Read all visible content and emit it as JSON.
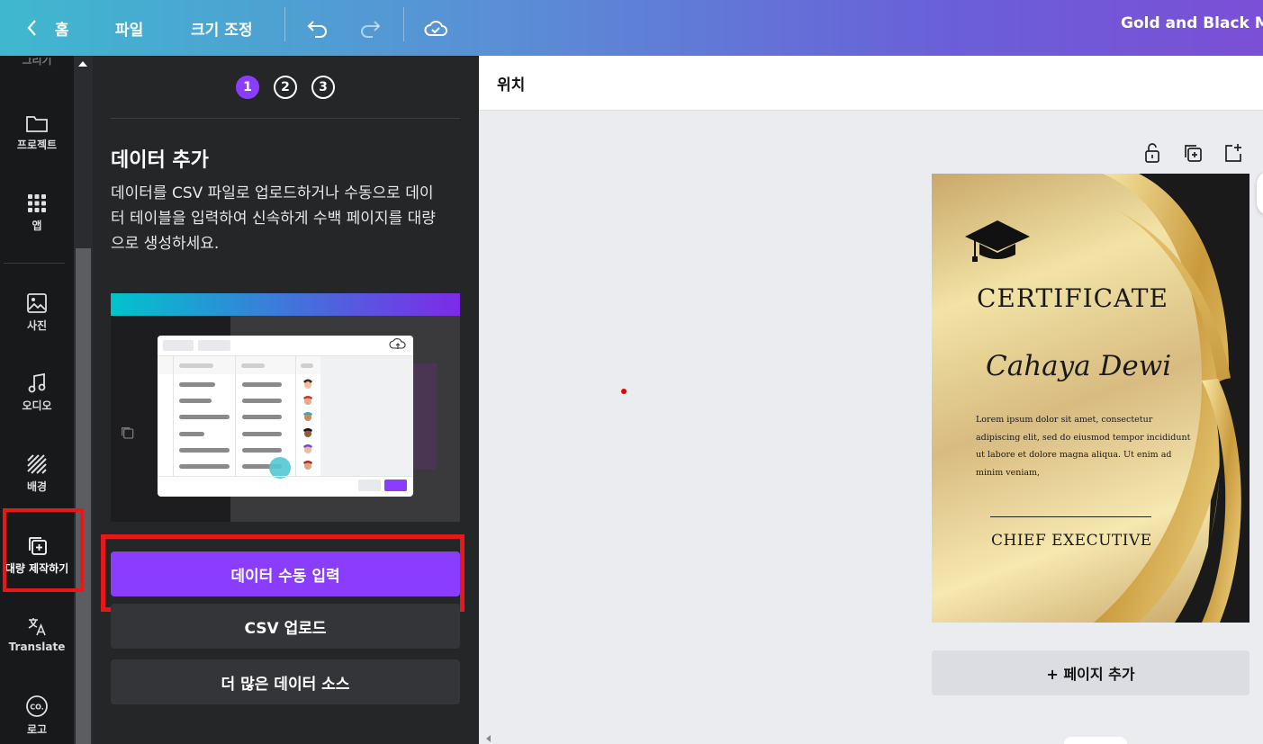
{
  "topbar": {
    "back_icon": "chevron-left-icon",
    "home_label": "홈",
    "file_label": "파일",
    "resize_label": "크기 조정",
    "undo_icon": "undo-icon",
    "redo_icon": "redo-icon",
    "cloud_icon": "cloud-check-icon",
    "doc_title": "Gold and Black Mo"
  },
  "rail": {
    "top_cut_label": "그리기",
    "items": [
      {
        "label": "프로젝트",
        "icon": "folder-icon"
      },
      {
        "label": "앱",
        "icon": "apps-grid-icon"
      },
      {
        "label": "사진",
        "icon": "image-icon"
      },
      {
        "label": "오디오",
        "icon": "music-note-icon"
      },
      {
        "label": "배경",
        "icon": "background-hatch-icon"
      },
      {
        "label": "대량 제작하기",
        "icon": "bulk-create-icon"
      },
      {
        "label": "Translate",
        "icon": "translate-icon"
      },
      {
        "label": "로고",
        "icon": "logo-co-icon"
      }
    ]
  },
  "panel": {
    "steps": [
      "1",
      "2",
      "3"
    ],
    "active_step": "1",
    "title": "데이터 추가",
    "description": "데이터를 CSV 파일로 업로드하거나 수동으로 데이터 테이블을 입력하여 신속하게 수백 페이지를 대량으로 생성하세요.",
    "primary_button": "데이터 수동 입력",
    "csv_button": "CSV 업로드",
    "more_button": "더 많은 데이터 소스"
  },
  "canvas": {
    "header": "위치",
    "page_tools": [
      "lock-icon",
      "duplicate-page-icon",
      "add-page-icon"
    ],
    "add_page_label": "+ 페이지 추가",
    "certificate": {
      "title": "CERTIFICATE",
      "name": "Cahaya Dewi",
      "body": "Lorem ipsum dolor sit amet, consectetur adipiscing elit, sed do eiusmod tempor incididunt ut labore et dolore magna aliqua. Ut enim ad minim veniam,",
      "signature_title": "CHIEF EXECUTIVE"
    }
  },
  "colors": {
    "accent_purple": "#8b3dff",
    "highlight_red": "#e8181a",
    "panel_bg": "#252627",
    "rail_bg": "#18191b"
  }
}
